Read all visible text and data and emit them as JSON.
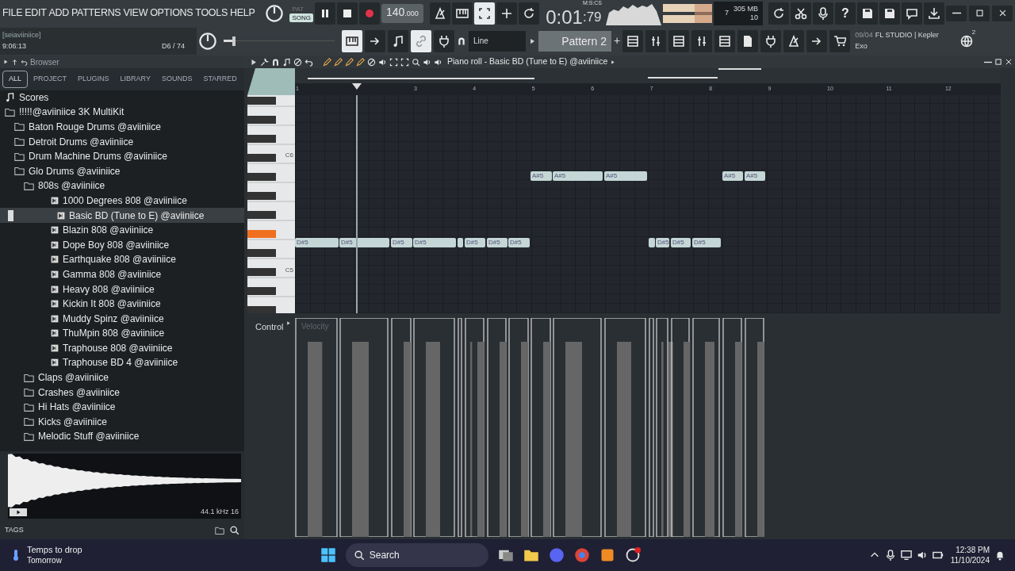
{
  "menu": [
    "FILE",
    "EDIT",
    "ADD",
    "PATTERNS",
    "VIEW",
    "OPTIONS",
    "TOOLS",
    "HELP"
  ],
  "transport": {
    "modes": [
      {
        "label": "PAT",
        "selected": false
      },
      {
        "label": "SONG",
        "selected": true
      }
    ],
    "tempo": "140",
    "tempo_decimals": ".000",
    "time": "0:01",
    "time_cs": ":79",
    "time_unit": "M:S:CS"
  },
  "meters": {
    "cpu": "7",
    "memory": "305 MB",
    "polyphony": "10"
  },
  "help_label": "?",
  "hint": {
    "user": "[seiaviiniice]",
    "time": "9:06:13",
    "note": "D6 / 74"
  },
  "pitch_slider": {
    "level": 0.11
  },
  "snap": "Line",
  "pattern": "Pattern 2",
  "add_pattern": "+",
  "news": {
    "date": "09/04",
    "title": "FL STUDIO | Kepler",
    "subtitle": "Exo"
  },
  "notifications": "2",
  "browser": {
    "title": "Browser",
    "tabs": [
      {
        "label": "ALL",
        "selected": true
      },
      {
        "label": "PROJECT",
        "selected": false
      },
      {
        "label": "PLUGINS",
        "selected": false
      },
      {
        "label": "LIBRARY",
        "selected": false
      },
      {
        "label": "SOUNDS",
        "selected": false
      },
      {
        "label": "STARRED",
        "selected": false
      }
    ],
    "tree": [
      {
        "kind": "score",
        "label": "Scores"
      },
      {
        "kind": "folder",
        "label": "!!!!!@aviiniice 3K MultiKit",
        "children": [
          {
            "kind": "folder",
            "label": "Baton Rouge Drums @aviiniice"
          },
          {
            "kind": "folder",
            "label": "Detroit Drums @aviiniice"
          },
          {
            "kind": "folder",
            "label": "Drum Machine Drums @aviiniice"
          },
          {
            "kind": "folder",
            "label": "Glo Drums @aviiniice",
            "children": [
              {
                "kind": "folder",
                "label": "808s @aviiniice",
                "children": [
                  {
                    "kind": "file",
                    "label": "1000 Degrees 808 @aviiniice",
                    "selected": false
                  },
                  {
                    "kind": "file",
                    "label": "Basic BD (Tune to E) @aviiniice",
                    "selected": true
                  },
                  {
                    "kind": "file",
                    "label": "Blazin 808 @aviiniice",
                    "selected": false
                  },
                  {
                    "kind": "file",
                    "label": "Dope Boy 808 @aviiniice",
                    "selected": false
                  },
                  {
                    "kind": "file",
                    "label": "Earthquake 808 @aviiniice",
                    "selected": false
                  },
                  {
                    "kind": "file",
                    "label": "Gamma 808 @aviiniice",
                    "selected": false
                  },
                  {
                    "kind": "file",
                    "label": "Heavy 808 @aviiniice",
                    "selected": false
                  },
                  {
                    "kind": "file",
                    "label": "Kickin It 808 @aviiniice",
                    "selected": false
                  },
                  {
                    "kind": "file",
                    "label": "Muddy Spinz @aviiniice",
                    "selected": false
                  },
                  {
                    "kind": "file",
                    "label": "ThuMpin 808 @aviiniice",
                    "selected": false
                  },
                  {
                    "kind": "file",
                    "label": "Traphouse 808 @aviiniice",
                    "selected": false
                  },
                  {
                    "kind": "file",
                    "label": "Traphouse BD 4 @aviiniice",
                    "selected": false
                  }
                ]
              },
              {
                "kind": "folder",
                "label": "Claps @aviiniice"
              },
              {
                "kind": "folder",
                "label": "Crashes @aviiniice"
              },
              {
                "kind": "folder",
                "label": "Hi Hats @aviiniice"
              },
              {
                "kind": "folder",
                "label": "Kicks @aviiniice"
              },
              {
                "kind": "folder",
                "label": "Melodic Stuff @aviiniice"
              }
            ]
          }
        ]
      }
    ],
    "sample_info": "44.1 kHz 16",
    "tags": "TAGS"
  },
  "piano_roll": {
    "title": "Piano roll - Basic BD (Tune to E) @aviiniice",
    "key_labels": [
      "C6",
      "C5"
    ],
    "ruler": [
      "1",
      "3",
      "4",
      "5",
      "6",
      "7",
      "8",
      "9",
      "10",
      "11",
      "12"
    ],
    "rows": [
      {
        "notes": [
          {
            "kind": "labeled",
            "label": "A#5"
          },
          {
            "kind": "labeled",
            "label": "A#5"
          },
          {
            "kind": "labeled",
            "label": "A#5"
          },
          {
            "kind": "labeled",
            "label": "A#5"
          },
          {
            "kind": "labeled",
            "label": "A#5"
          }
        ]
      },
      {
        "notes": [
          {
            "kind": "labeled",
            "label": "D#5"
          },
          {
            "kind": "labeled",
            "label": "D#5"
          },
          {
            "kind": "labeled",
            "label": "D#5"
          },
          {
            "kind": "labeled",
            "label": "D#5"
          },
          {
            "kind": "blank"
          },
          {
            "kind": "labeled",
            "label": "D#5"
          },
          {
            "kind": "labeled",
            "label": "D#5"
          },
          {
            "kind": "labeled",
            "label": "D#5"
          },
          {
            "kind": "blank"
          },
          {
            "kind": "labeled",
            "label": "D#5"
          },
          {
            "kind": "labeled",
            "label": "D#5"
          },
          {
            "kind": "labeled",
            "label": "D#5"
          }
        ]
      }
    ],
    "control": "Control",
    "control_target": "Velocity"
  },
  "taskbar": {
    "weather": {
      "title": "Temps to drop",
      "subtitle": "Tomorrow"
    },
    "search": "Search",
    "time": "12:38 PM",
    "date": "11/10/2024"
  }
}
